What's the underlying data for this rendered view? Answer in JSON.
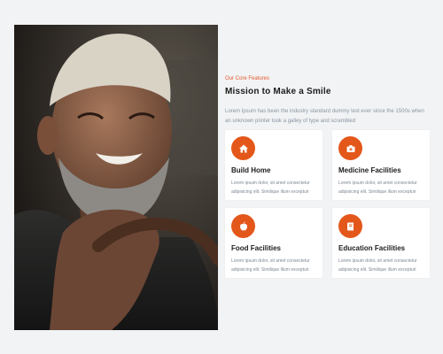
{
  "features": {
    "kicker": "Our Core Features",
    "title": "Mission to Make a Smile",
    "description": "Lorem Ipsum has been the industry standard dummy text ever since the 1500s when an unknown printer took a galley of type and scrambled",
    "items": [
      {
        "icon": "home-icon",
        "title": "Build Home",
        "text": "Lorem ipsum dolor, sit amet consectetur adipisicing elit. Similique illum excepturi"
      },
      {
        "icon": "medical-bag-icon",
        "title": "Medicine Facilities",
        "text": "Lorem ipsum dolor, sit amet consectetur adipisicing elit. Similique illum excepturi"
      },
      {
        "icon": "apple-icon",
        "title": "Food Facilities",
        "text": "Lorem ipsum dolor, sit amet consectetur adipisicing elit. Similique illum excepturi"
      },
      {
        "icon": "book-icon",
        "title": "Education Facilities",
        "text": "Lorem ipsum dolor, sit amet consectetur adipisicing elit. Similique illum excepturi"
      }
    ]
  },
  "colors": {
    "accent": "#e4571a",
    "heading": "#1c1c1c",
    "muted": "#8a95a3",
    "background": "#f1f3f4",
    "card": "#ffffff"
  }
}
